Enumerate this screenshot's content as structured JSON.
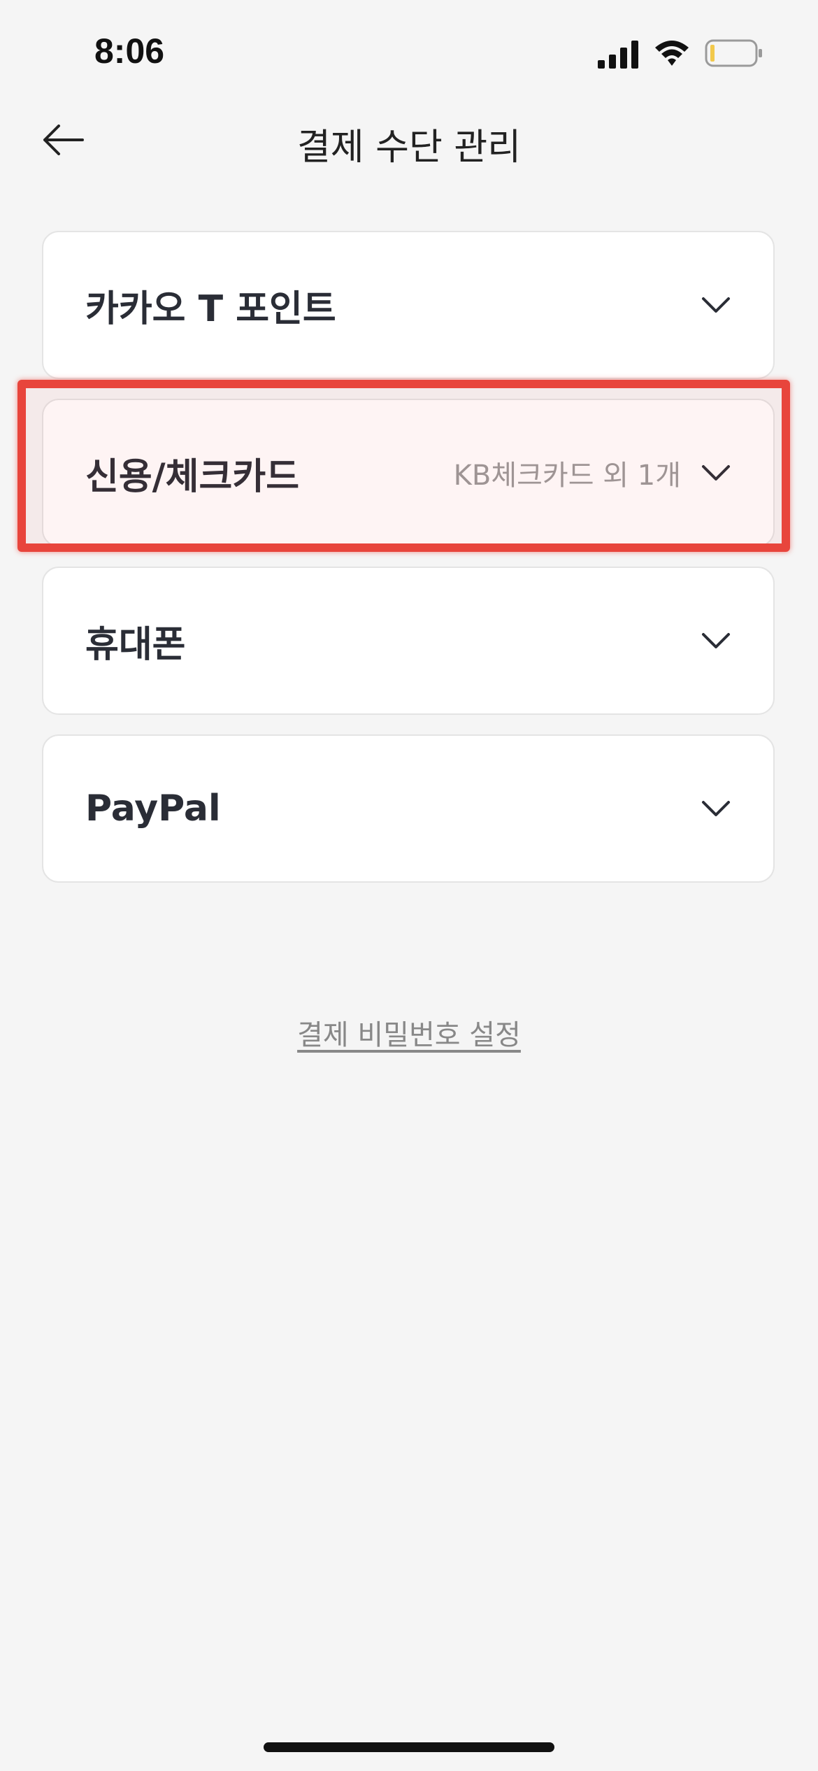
{
  "status_bar": {
    "time": "8:06",
    "icons": [
      "signal-icon",
      "wifi-icon",
      "battery-icon"
    ]
  },
  "header": {
    "title": "결제 수단 관리",
    "back_icon": "arrow-left-icon"
  },
  "payment_methods": [
    {
      "label": "카카오 T 포인트",
      "sub": ""
    },
    {
      "label": "신용/체크카드",
      "sub": "KB체크카드 외 1개"
    },
    {
      "label": "휴대폰",
      "sub": ""
    },
    {
      "label": "PayPal",
      "sub": ""
    }
  ],
  "footer": {
    "password_link": "결제 비밀번호 설정"
  },
  "colors": {
    "background": "#f5f5f5",
    "card": "#ffffff",
    "highlight": "#e8453c",
    "label": "#2a2d36",
    "sub_text": "#9a9a9a"
  }
}
